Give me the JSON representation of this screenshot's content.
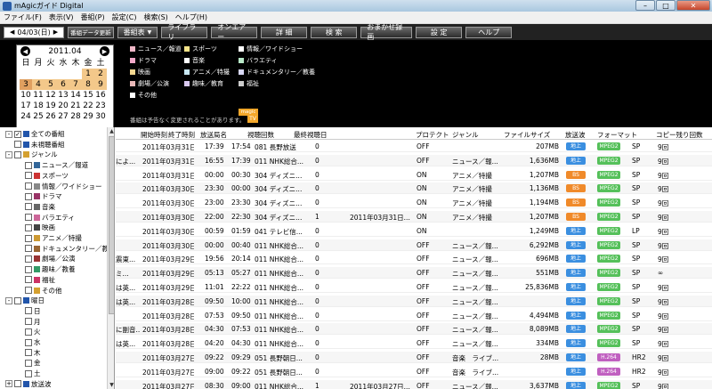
{
  "window": {
    "title": "mAgicガイド Digital"
  },
  "menu": [
    "ファイル(F)",
    "表示(V)",
    "番組(P)",
    "設定(C)",
    "検索(S)",
    "ヘルプ(H)"
  ],
  "toolbar": {
    "date": "04/03(日)",
    "update_label": "番組データ更新",
    "guide_label": "番組表",
    "buttons": [
      "ライブラリ",
      "オンエアー",
      "詳 細",
      "検 索",
      "おまかせ録画",
      "設 定",
      "ヘルプ"
    ]
  },
  "calendar": {
    "month": "2011.04",
    "weekdays": [
      "日",
      "月",
      "火",
      "水",
      "木",
      "金",
      "土"
    ],
    "days": [
      [
        "",
        "",
        "",
        "",
        "",
        "1",
        "2"
      ],
      [
        "3",
        "4",
        "5",
        "6",
        "7",
        "8",
        "9"
      ],
      [
        "10",
        "11",
        "12",
        "13",
        "14",
        "15",
        "16"
      ],
      [
        "17",
        "18",
        "19",
        "20",
        "21",
        "22",
        "23"
      ],
      [
        "24",
        "25",
        "26",
        "27",
        "28",
        "29",
        "30"
      ]
    ]
  },
  "genres": [
    {
      "label": "ニュース／報道",
      "color": "#f0b8c8"
    },
    {
      "label": "スポーツ",
      "color": "#f5e48a"
    },
    {
      "label": "情報／ワイドショー",
      "color": "#ffffff"
    },
    {
      "label": "ドラマ",
      "color": "#f2a8c8"
    },
    {
      "label": "音楽",
      "color": "#ffffff"
    },
    {
      "label": "バラエティ",
      "color": "#b8e8c8"
    },
    {
      "label": "映画",
      "color": "#f5d890"
    },
    {
      "label": "アニメ／特撮",
      "color": "#c8e8f5"
    },
    {
      "label": "ドキュメンタリー／教養",
      "color": "#d8d8f5"
    },
    {
      "label": "劇場／公演",
      "color": "#e8b8b8"
    },
    {
      "label": "趣味／教育",
      "color": "#d8c8f0"
    },
    {
      "label": "福祉",
      "color": "#cccccc"
    },
    {
      "label": "その他",
      "color": "#ffffff"
    }
  ],
  "footnote": "番組は予告なく変更されることがあります。",
  "logo": {
    "top": "magic",
    "bottom": "TV"
  },
  "tree": [
    {
      "label": "全ての番組",
      "indent": 0,
      "exp": "-",
      "checked": true,
      "icon": "#2255aa"
    },
    {
      "label": "未視聴番組",
      "indent": 0,
      "exp": "",
      "checked": false,
      "icon": "#2255aa"
    },
    {
      "label": "ジャンル",
      "indent": 0,
      "exp": "-",
      "checked": false,
      "icon": "#d4a030"
    },
    {
      "label": "ニュース／報道",
      "indent": 1,
      "exp": "",
      "checked": false,
      "icon": "#336699"
    },
    {
      "label": "スポーツ",
      "indent": 1,
      "exp": "",
      "checked": false,
      "icon": "#cc3333"
    },
    {
      "label": "情報／ワイドショー",
      "indent": 1,
      "exp": "",
      "checked": false,
      "icon": "#888888"
    },
    {
      "label": "ドラマ",
      "indent": 1,
      "exp": "",
      "checked": false,
      "icon": "#993366"
    },
    {
      "label": "音楽",
      "indent": 1,
      "exp": "",
      "checked": false,
      "icon": "#666666"
    },
    {
      "label": "バラエティ",
      "indent": 1,
      "exp": "",
      "checked": false,
      "icon": "#cc6699"
    },
    {
      "label": "映画",
      "indent": 1,
      "exp": "",
      "checked": false,
      "icon": "#444444"
    },
    {
      "label": "アニメ／特撮",
      "indent": 1,
      "exp": "",
      "checked": false,
      "icon": "#cc9933"
    },
    {
      "label": "ドキュメンタリー／教",
      "indent": 1,
      "exp": "",
      "checked": false,
      "icon": "#996633"
    },
    {
      "label": "劇場／公演",
      "indent": 1,
      "exp": "",
      "checked": false,
      "icon": "#993333"
    },
    {
      "label": "趣味／教養",
      "indent": 1,
      "exp": "",
      "checked": false,
      "icon": "#339966"
    },
    {
      "label": "福祉",
      "indent": 1,
      "exp": "",
      "checked": false,
      "icon": "#cc3366"
    },
    {
      "label": "その他",
      "indent": 1,
      "exp": "",
      "checked": false,
      "icon": "#d4a030"
    },
    {
      "label": "曜日",
      "indent": 0,
      "exp": "-",
      "checked": false,
      "icon": "#2255aa"
    },
    {
      "label": "日",
      "indent": 1,
      "exp": "",
      "checked": false,
      "icon": ""
    },
    {
      "label": "月",
      "indent": 1,
      "exp": "",
      "checked": false,
      "icon": ""
    },
    {
      "label": "火",
      "indent": 1,
      "exp": "",
      "checked": false,
      "icon": ""
    },
    {
      "label": "水",
      "indent": 1,
      "exp": "",
      "checked": false,
      "icon": ""
    },
    {
      "label": "木",
      "indent": 1,
      "exp": "",
      "checked": false,
      "icon": ""
    },
    {
      "label": "金",
      "indent": 1,
      "exp": "",
      "checked": false,
      "icon": ""
    },
    {
      "label": "土",
      "indent": 1,
      "exp": "",
      "checked": false,
      "icon": ""
    },
    {
      "label": "放送波",
      "indent": 0,
      "exp": "+",
      "checked": false,
      "icon": "#2255aa"
    }
  ],
  "table": {
    "columns": [
      "開始時刻",
      "終了時刻",
      "放送局名",
      "視聴回数",
      "最終視聴日",
      "プロテクト",
      "ジャンル",
      "ファイルサイズ",
      "放送波",
      "フォーマット",
      "コピー残り回数"
    ],
    "rows": [
      {
        "title": "",
        "date": "2011年03月31日...",
        "start": "17:39",
        "end": "17:54",
        "ch": "081 長野放送",
        "views": "0",
        "last": "",
        "protect": "OFF",
        "genre": "",
        "size": "207MB",
        "wave": "地上",
        "wave_color": "#3b8fe0",
        "fmt": "MPEG2",
        "fmt_color": "#55c05a",
        "mode": "SP",
        "copy": "9回"
      },
      {
        "title": "によ...",
        "date": "2011年03月31日...",
        "start": "16:55",
        "end": "17:39",
        "ch": "011 NHK総合...",
        "views": "0",
        "last": "",
        "protect": "OFF",
        "genre": "ニュース／報...",
        "size": "1,636MB",
        "wave": "地上",
        "wave_color": "#3b8fe0",
        "fmt": "MPEG2",
        "fmt_color": "#55c05a",
        "mode": "SP",
        "copy": "9回"
      },
      {
        "title": "",
        "date": "2011年03月31日...",
        "start": "00:00",
        "end": "00:30",
        "ch": "304 ディズニ...",
        "views": "0",
        "last": "",
        "protect": "ON",
        "genre": "アニメ／特撮",
        "size": "1,207MB",
        "wave": "BS",
        "wave_color": "#f08a2a",
        "fmt": "MPEG2",
        "fmt_color": "#55c05a",
        "mode": "SP",
        "copy": "9回"
      },
      {
        "title": "",
        "date": "2011年03月30日...",
        "start": "23:30",
        "end": "00:00",
        "ch": "304 ディズニ...",
        "views": "0",
        "last": "",
        "protect": "ON",
        "genre": "アニメ／特撮",
        "size": "1,136MB",
        "wave": "BS",
        "wave_color": "#f08a2a",
        "fmt": "MPEG2",
        "fmt_color": "#55c05a",
        "mode": "SP",
        "copy": "9回"
      },
      {
        "title": "",
        "date": "2011年03月30日...",
        "start": "23:00",
        "end": "23:30",
        "ch": "304 ディズニ...",
        "views": "0",
        "last": "",
        "protect": "ON",
        "genre": "アニメ／特撮",
        "size": "1,194MB",
        "wave": "BS",
        "wave_color": "#f08a2a",
        "fmt": "MPEG2",
        "fmt_color": "#55c05a",
        "mode": "SP",
        "copy": "9回"
      },
      {
        "title": "",
        "date": "2011年03月30日...",
        "start": "22:00",
        "end": "22:30",
        "ch": "304 ディズニ...",
        "views": "1",
        "last": "2011年03月31日...",
        "protect": "ON",
        "genre": "アニメ／特撮",
        "size": "1,207MB",
        "wave": "BS",
        "wave_color": "#f08a2a",
        "fmt": "MPEG2",
        "fmt_color": "#55c05a",
        "mode": "SP",
        "copy": "9回"
      },
      {
        "title": "",
        "date": "2011年03月30日...",
        "start": "00:59",
        "end": "01:59",
        "ch": "041 テレビ信...",
        "views": "0",
        "last": "",
        "protect": "ON",
        "genre": "",
        "size": "1,249MB",
        "wave": "地上",
        "wave_color": "#3b8fe0",
        "fmt": "MPEG2",
        "fmt_color": "#55c05a",
        "mode": "LP",
        "copy": "9回"
      },
      {
        "title": "",
        "date": "2011年03月30日...",
        "start": "00:00",
        "end": "00:40",
        "ch": "011 NHK総合...",
        "views": "0",
        "last": "",
        "protect": "OFF",
        "genre": "ニュース／報...",
        "size": "6,292MB",
        "wave": "地上",
        "wave_color": "#3b8fe0",
        "fmt": "MPEG2",
        "fmt_color": "#55c05a",
        "mode": "SP",
        "copy": "9回"
      },
      {
        "title": "震東...",
        "date": "2011年03月29日...",
        "start": "19:56",
        "end": "20:14",
        "ch": "011 NHK総合...",
        "views": "0",
        "last": "",
        "protect": "OFF",
        "genre": "ニュース／報...",
        "size": "696MB",
        "wave": "地上",
        "wave_color": "#3b8fe0",
        "fmt": "MPEG2",
        "fmt_color": "#55c05a",
        "mode": "SP",
        "copy": "9回"
      },
      {
        "title": "ミ...",
        "date": "2011年03月29日...",
        "start": "05:13",
        "end": "05:27",
        "ch": "011 NHK総合...",
        "views": "0",
        "last": "",
        "protect": "OFF",
        "genre": "ニュース／報...",
        "size": "551MB",
        "wave": "地上",
        "wave_color": "#3b8fe0",
        "fmt": "MPEG2",
        "fmt_color": "#55c05a",
        "mode": "SP",
        "copy": "∞"
      },
      {
        "title": "は英...",
        "date": "2011年03月29日...",
        "start": "11:01",
        "end": "22:22",
        "ch": "011 NHK総合...",
        "views": "0",
        "last": "",
        "protect": "OFF",
        "genre": "ニュース／報...",
        "size": "25,836MB",
        "wave": "地上",
        "wave_color": "#3b8fe0",
        "fmt": "MPEG2",
        "fmt_color": "#55c05a",
        "mode": "SP",
        "copy": "9回"
      },
      {
        "title": "は英...",
        "date": "2011年03月28日...",
        "start": "09:50",
        "end": "10:00",
        "ch": "011 NHK総合...",
        "views": "0",
        "last": "",
        "protect": "OFF",
        "genre": "ニュース／報...",
        "size": "",
        "wave": "地上",
        "wave_color": "#3b8fe0",
        "fmt": "MPEG2",
        "fmt_color": "#55c05a",
        "mode": "SP",
        "copy": "9回"
      },
      {
        "title": "",
        "date": "2011年03月28日...",
        "start": "07:53",
        "end": "09:50",
        "ch": "011 NHK総合...",
        "views": "0",
        "last": "",
        "protect": "OFF",
        "genre": "ニュース／報...",
        "size": "4,494MB",
        "wave": "地上",
        "wave_color": "#3b8fe0",
        "fmt": "MPEG2",
        "fmt_color": "#55c05a",
        "mode": "SP",
        "copy": "9回"
      },
      {
        "title": "に副音...",
        "date": "2011年03月28日...",
        "start": "04:30",
        "end": "07:53",
        "ch": "011 NHK総合...",
        "views": "0",
        "last": "",
        "protect": "OFF",
        "genre": "ニュース／報...",
        "size": "8,089MB",
        "wave": "地上",
        "wave_color": "#3b8fe0",
        "fmt": "MPEG2",
        "fmt_color": "#55c05a",
        "mode": "SP",
        "copy": "9回"
      },
      {
        "title": "は英...",
        "date": "2011年03月28日...",
        "start": "04:20",
        "end": "04:30",
        "ch": "011 NHK総合...",
        "views": "0",
        "last": "",
        "protect": "OFF",
        "genre": "ニュース／報...",
        "size": "334MB",
        "wave": "地上",
        "wave_color": "#3b8fe0",
        "fmt": "MPEG2",
        "fmt_color": "#55c05a",
        "mode": "SP",
        "copy": "9回"
      },
      {
        "title": "",
        "date": "2011年03月27日...",
        "start": "09:22",
        "end": "09:29",
        "ch": "051 長野朝日...",
        "views": "0",
        "last": "",
        "protect": "OFF",
        "genre": "音楽　ライブ...",
        "size": "28MB",
        "wave": "地上",
        "wave_color": "#3b8fe0",
        "fmt": "H.264",
        "fmt_color": "#c060c0",
        "mode": "HR2",
        "copy": "9回"
      },
      {
        "title": "",
        "date": "2011年03月27日...",
        "start": "09:00",
        "end": "09:22",
        "ch": "051 長野朝日...",
        "views": "0",
        "last": "",
        "protect": "OFF",
        "genre": "音楽　ライブ...",
        "size": "",
        "wave": "地上",
        "wave_color": "#3b8fe0",
        "fmt": "H.264",
        "fmt_color": "#c060c0",
        "mode": "HR2",
        "copy": "9回"
      },
      {
        "title": "",
        "date": "2011年03月27日...",
        "start": "08:30",
        "end": "09:00",
        "ch": "011 NHK総合...",
        "views": "1",
        "last": "2011年03月27日...",
        "protect": "OFF",
        "genre": "ニュース／報...",
        "size": "3,637MB",
        "wave": "地上",
        "wave_color": "#3b8fe0",
        "fmt": "MPEG2",
        "fmt_color": "#55c05a",
        "mode": "SP",
        "copy": "9回"
      }
    ]
  }
}
